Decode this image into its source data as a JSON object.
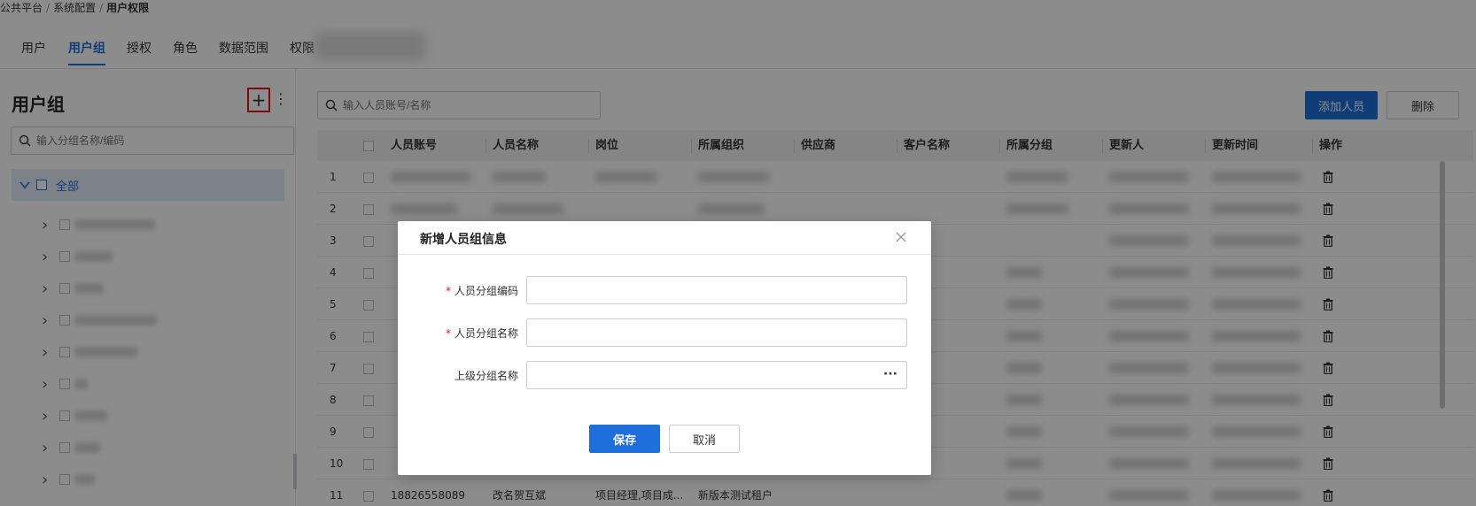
{
  "breadcrumb": {
    "items": [
      "公共平台",
      "系统配置",
      "用户权限"
    ],
    "separator": "/"
  },
  "tabs": [
    {
      "label": "用户",
      "active": false
    },
    {
      "label": "用户组",
      "active": true
    },
    {
      "label": "授权",
      "active": false
    },
    {
      "label": "角色",
      "active": false
    },
    {
      "label": "数据范围",
      "active": false
    },
    {
      "label": "权限",
      "active": false
    }
  ],
  "sidebar": {
    "title": "用户组",
    "add_icon": "plus-icon",
    "more_icon": "more-vertical-icon",
    "search_placeholder": "输入分组名称/编码",
    "tree_root_label": "全部"
  },
  "main": {
    "search_placeholder": "输入人员账号/名称",
    "add_button": "添加人员",
    "delete_button": "删除",
    "columns": [
      "人员账号",
      "人员名称",
      "岗位",
      "所属组织",
      "供应商",
      "客户名称",
      "所属分组",
      "更新人",
      "更新时间",
      "操作"
    ],
    "row_numbers": [
      "1",
      "2",
      "3",
      "4",
      "5",
      "6",
      "7",
      "8",
      "9",
      "10",
      "11"
    ],
    "last_row": {
      "account": "18826558089",
      "name": "改名贺互斌",
      "position": "项目经理,项目成...",
      "org": "新版本测试租户"
    }
  },
  "dialog": {
    "title": "新增人员组信息",
    "fields": [
      {
        "label": "人员分组编码",
        "required": true,
        "value": ""
      },
      {
        "label": "人员分组名称",
        "required": true,
        "value": ""
      },
      {
        "label": "上级分组名称",
        "required": false,
        "value": ""
      }
    ],
    "required_mark": "*",
    "ellipsis_button": "···",
    "save_button": "保存",
    "cancel_button": "取消"
  },
  "colors": {
    "accent": "#1e6fd9",
    "highlight_border": "#e5131f"
  }
}
